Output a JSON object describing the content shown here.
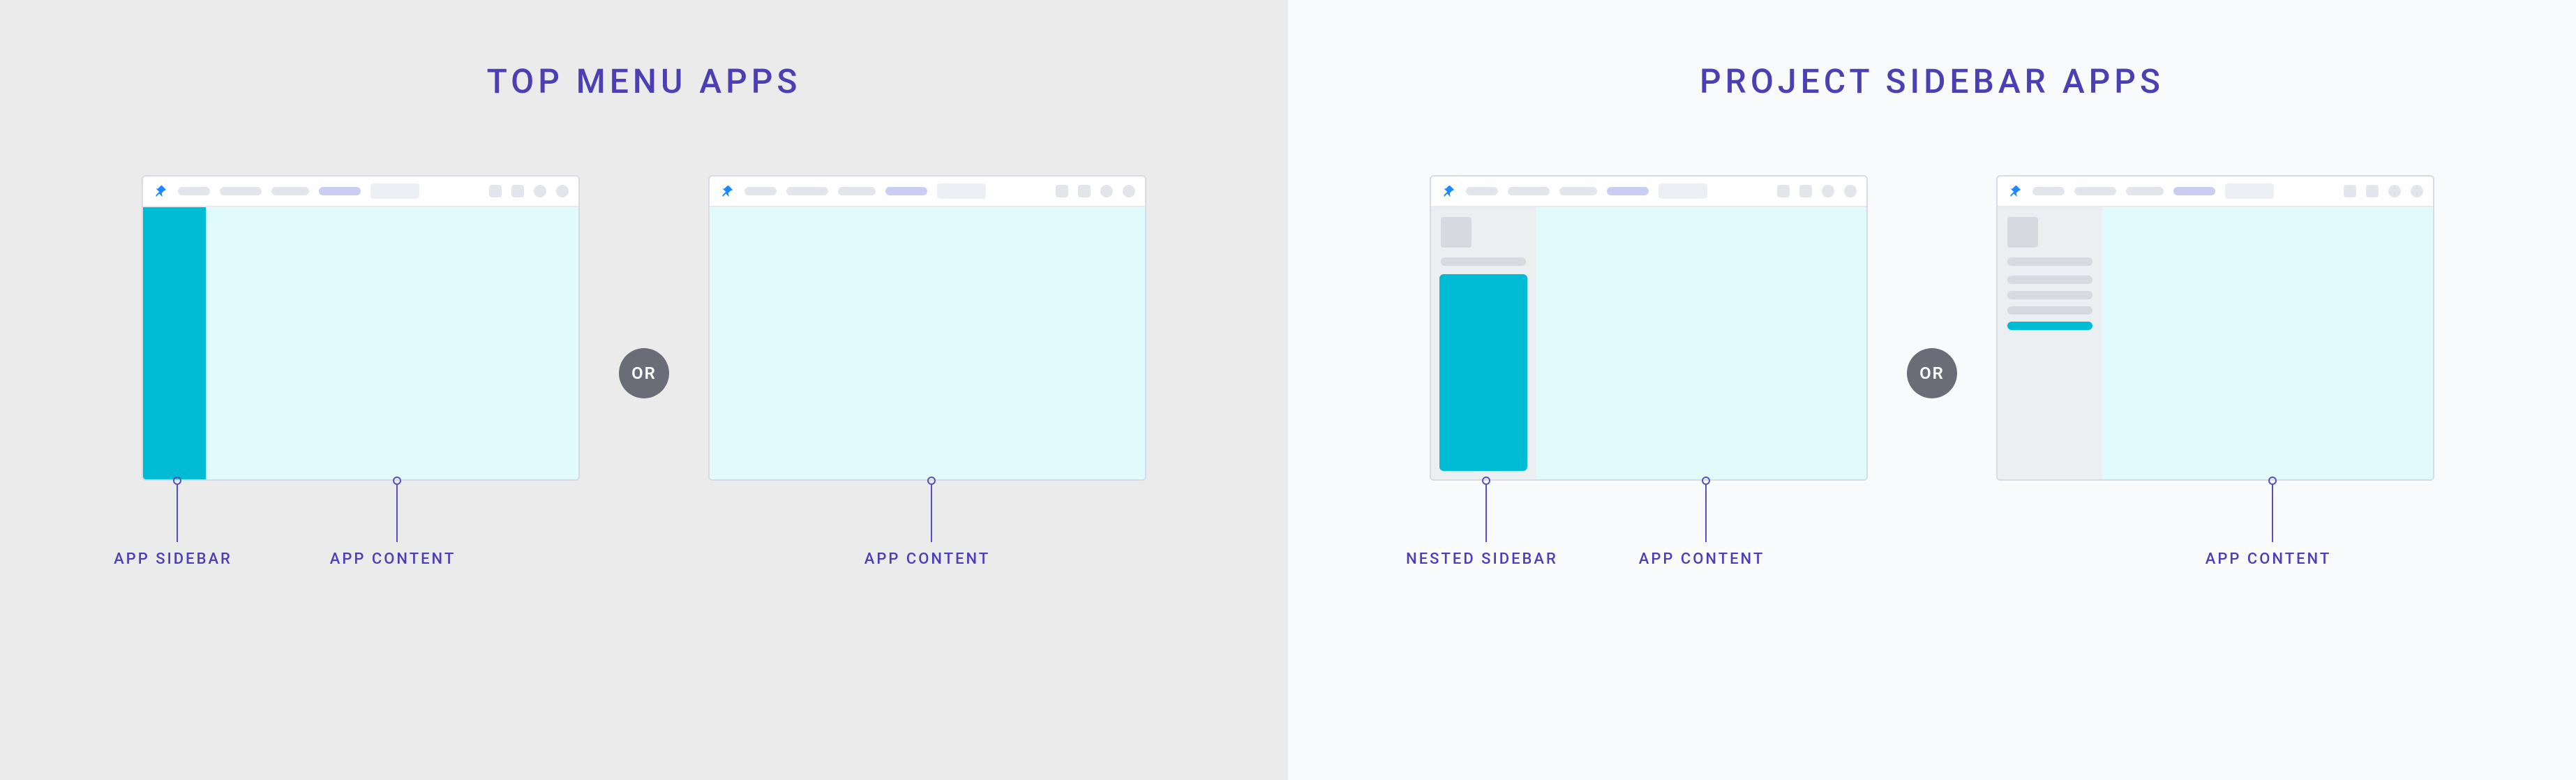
{
  "left": {
    "title": "TOP MENU APPS",
    "or": "OR",
    "example_a": {
      "labels": {
        "sidebar": "APP SIDEBAR",
        "content": "APP CONTENT"
      }
    },
    "example_b": {
      "labels": {
        "content": "APP CONTENT"
      }
    }
  },
  "right": {
    "title": "PROJECT SIDEBAR APPS",
    "or": "OR",
    "example_a": {
      "labels": {
        "sidebar": "NESTED SIDEBAR",
        "content": "APP CONTENT"
      }
    },
    "example_b": {
      "labels": {
        "content": "APP CONTENT"
      }
    }
  },
  "icons": {
    "logo": "pin-icon"
  },
  "colors": {
    "accent_purple": "#4C3FB3",
    "accent_cyan": "#00BBD4",
    "content_bg": "#E1FAFB",
    "or_badge": "#6A6D77",
    "left_panel_bg": "#EBEBEC",
    "right_panel_bg": "#F9FAFC"
  }
}
